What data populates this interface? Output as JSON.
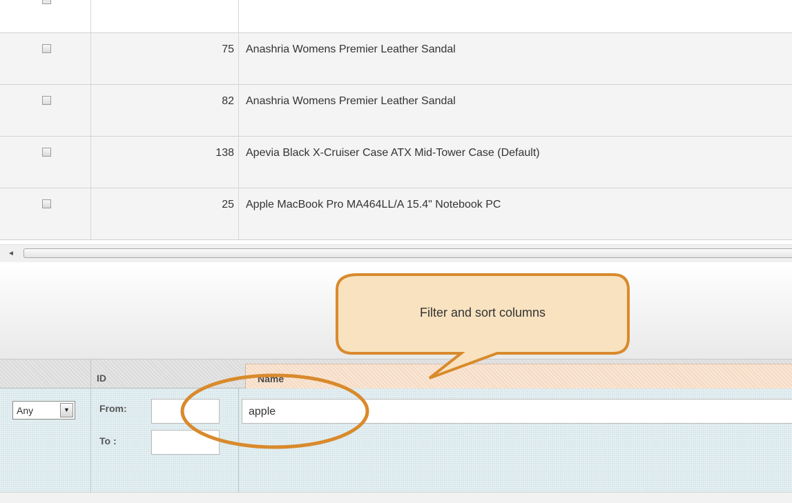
{
  "grid": {
    "rows": [
      {
        "id": "75",
        "name": "Anashria Womens Premier Leather Sandal"
      },
      {
        "id": "82",
        "name": "Anashria Womens Premier Leather Sandal"
      },
      {
        "id": "138",
        "name": "Apevia Black X-Cruiser Case ATX Mid-Tower Case (Default)"
      },
      {
        "id": "25",
        "name": "Apple MacBook Pro MA464LL/A 15.4\" Notebook PC"
      }
    ]
  },
  "scrollbar": {
    "left_arrow": "◄"
  },
  "columns": {
    "id_label": "ID",
    "name_label": "Name"
  },
  "filters": {
    "select_value": "Any",
    "select_arrow": "▼",
    "from_label": "From:",
    "to_label": "To :",
    "from_value": "",
    "to_value": "",
    "name_value": "apple"
  },
  "callout": {
    "text": "Filter and sort columns"
  },
  "colors": {
    "callout_border": "#d98a2c",
    "callout_fill": "#f8e2c0",
    "name_header": "#f6dcc6",
    "filter_bg": "#d6e6ea"
  }
}
